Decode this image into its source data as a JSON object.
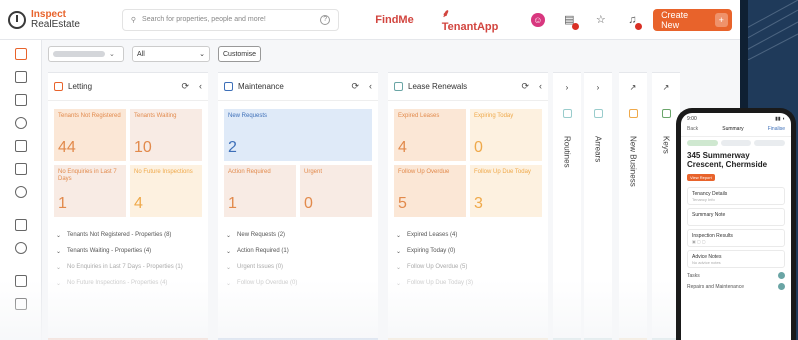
{
  "app": {
    "logo_line1": "Inspect",
    "logo_line2": "RealEstate"
  },
  "topbar": {
    "search_placeholder": "Search for properties, people and more!",
    "help_glyph": "?",
    "brand_findme": "FindMe",
    "brand_tenantapp": "TenantApp",
    "create_label": "Create New",
    "create_plus": "+"
  },
  "filters": {
    "type_value": "All",
    "customise_label": "Customise"
  },
  "colors": {
    "accent": "#e8632b",
    "letting_bar": "#e8632b",
    "maintenance_bar": "#3d6fb8",
    "lease_bar": "#efa94a",
    "routines_bar": "#6aa5a5",
    "new_business_bar": "#efa94a",
    "keys_bar": "#6aa5a5"
  },
  "panels": {
    "letting": {
      "title": "Letting",
      "tiles": [
        {
          "label": "Tenants Not Registered",
          "value": "44"
        },
        {
          "label": "Tenants Waiting",
          "value": "10"
        },
        {
          "label": "No Enquiries in Last 7 Days",
          "value": "1"
        },
        {
          "label": "No Future Inspections",
          "value": "4"
        }
      ],
      "list": [
        "Tenants Not Registered - Properties (8)",
        "Tenants Waiting - Properties (4)",
        "No Enquiries in Last 7 Days - Properties (1)",
        "No Future Inspections - Properties (4)"
      ]
    },
    "maintenance": {
      "title": "Maintenance",
      "tiles": [
        {
          "label": "New Requests",
          "value": "2"
        },
        {
          "label": "Action Required",
          "value": "1"
        },
        {
          "label": "Urgent",
          "value": "0"
        }
      ],
      "list": [
        "New Requests (2)",
        "Action Required (1)",
        "Urgent Issues (0)",
        "Follow Up Overdue (0)"
      ]
    },
    "lease": {
      "title": "Lease Renewals",
      "tiles": [
        {
          "label": "Expired Leases",
          "value": "4"
        },
        {
          "label": "Expiring Today",
          "value": "0"
        },
        {
          "label": "Follow Up Overdue",
          "value": "5"
        },
        {
          "label": "Follow Up Due Today",
          "value": "3"
        }
      ],
      "list": [
        "Expired Leases (4)",
        "Expiring Today (0)",
        "Follow Up Overdue (5)",
        "Follow Up Due Today (3)"
      ]
    }
  },
  "collapsed": [
    {
      "label": "Routines",
      "arrow": "›"
    },
    {
      "label": "Arrears",
      "arrow": "›"
    },
    {
      "label": "New Business",
      "arrow": "↗"
    },
    {
      "label": "Keys",
      "arrow": "↗"
    }
  ],
  "phone": {
    "time": "9:00",
    "nav_back": "Back",
    "nav_title": "Summary",
    "nav_action": "Finalise",
    "address": "345 Summerway Crescent, Chermside",
    "badge": "View Report",
    "cards": [
      {
        "title": "Tenancy Details",
        "sub": "Tenancy Info"
      },
      {
        "title": "Summary Note",
        "sub": ""
      },
      {
        "title": "Inspection Results",
        "sub": ""
      },
      {
        "title": "Advice Notes",
        "sub": "No advice notes"
      }
    ],
    "rows": [
      "Tasks",
      "Repairs and Maintenance"
    ]
  }
}
